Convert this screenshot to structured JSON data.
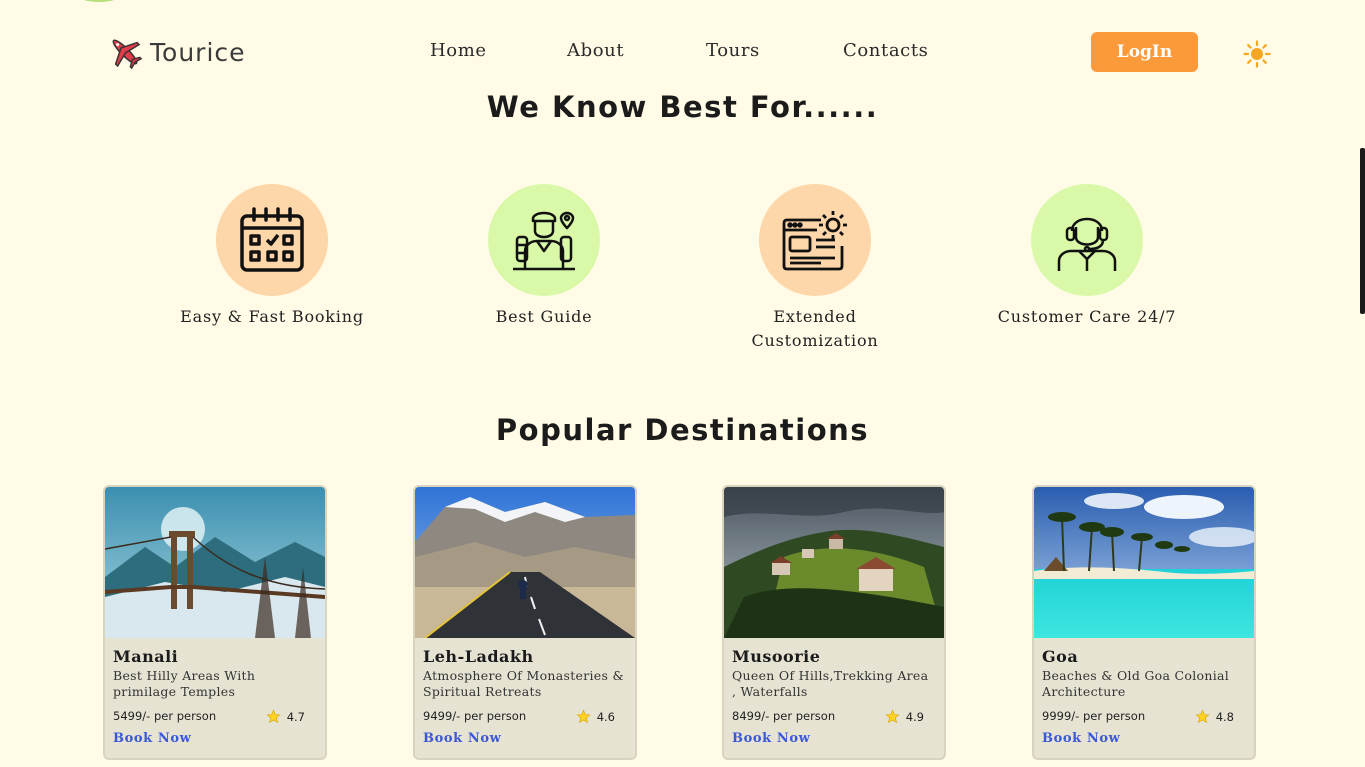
{
  "header": {
    "brand": "Tourice",
    "nav": [
      "Home",
      "About",
      "Tours",
      "Contacts"
    ],
    "login_label": "LogIn"
  },
  "features": {
    "heading": "We Know Best For......",
    "items": [
      {
        "label": "Easy & Fast Booking",
        "icon": "calendar-icon"
      },
      {
        "label": "Best Guide",
        "icon": "guide-icon"
      },
      {
        "label": "Extended Customization",
        "icon": "customize-icon"
      },
      {
        "label": "Customer Care 24/7",
        "icon": "support-agent-icon"
      }
    ]
  },
  "destinations": {
    "heading": "Popular Destinations",
    "cards": [
      {
        "name": "Manali",
        "desc": "Best Hilly Areas With primilage Temples",
        "price": "5499/- per person",
        "rating": "4.7",
        "cta": "Book Now"
      },
      {
        "name": "Leh-Ladakh",
        "desc": "Atmosphere Of Monasteries & Spiritual Retreats",
        "price": "9499/- per person",
        "rating": "4.6",
        "cta": "Book Now"
      },
      {
        "name": "Musoorie",
        "desc": "Queen Of Hills,Trekking Area , Waterfalls",
        "price": "8499/- per person",
        "rating": "4.9",
        "cta": "Book Now"
      },
      {
        "name": "Goa",
        "desc": "Beaches & Old Goa Colonial Architecture",
        "price": "9999/- per person",
        "rating": "4.8",
        "cta": "Book Now"
      }
    ]
  },
  "colors": {
    "background": "#fffbe6",
    "accent": "#fb9a3b",
    "link": "#3b58d8",
    "peach": "#fdd6a9",
    "green": "#d9f9a8"
  }
}
